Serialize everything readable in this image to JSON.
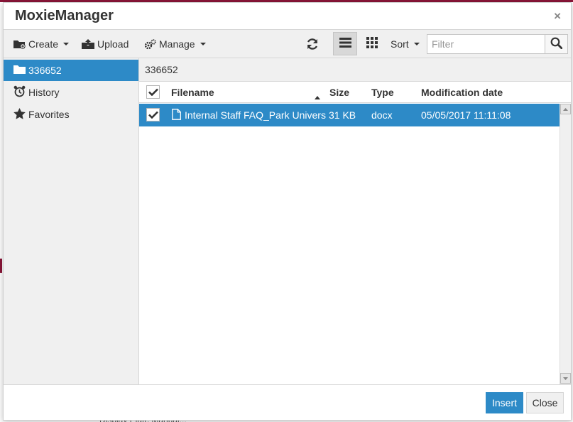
{
  "background": {
    "bottom_text": "Display Plate Manual..."
  },
  "dialog": {
    "title": "MoxieManager",
    "close_symbol": "×"
  },
  "toolbar": {
    "create_label": "Create",
    "upload_label": "Upload",
    "manage_label": "Manage",
    "sort_label": "Sort",
    "filter_placeholder": "Filter",
    "icons": [
      "create-folder-icon",
      "upload-icon",
      "manage-gears-icon",
      "refresh-icon",
      "list-view-icon",
      "grid-view-icon",
      "search-icon"
    ]
  },
  "sidebar": {
    "items": [
      {
        "label": "336652",
        "icon": "folder-icon",
        "active": true
      },
      {
        "label": "History",
        "icon": "alarm-clock-icon",
        "active": false
      },
      {
        "label": "Favorites",
        "icon": "star-icon",
        "active": false
      }
    ]
  },
  "content": {
    "path": "336652",
    "columns": {
      "filename": "Filename",
      "size": "Size",
      "type": "Type",
      "modified": "Modification date"
    },
    "files": [
      {
        "name": "Internal Staff FAQ_Park University.docx",
        "size": "31 KB",
        "type": "docx",
        "modified": "05/05/2017 11:11:08",
        "selected": true
      }
    ]
  },
  "footer": {
    "insert_label": "Insert",
    "close_label": "Close"
  },
  "colors": {
    "accent": "#2d8ac7",
    "toolbar_bg": "#f0f0f0",
    "brand_line": "#8a1538"
  }
}
